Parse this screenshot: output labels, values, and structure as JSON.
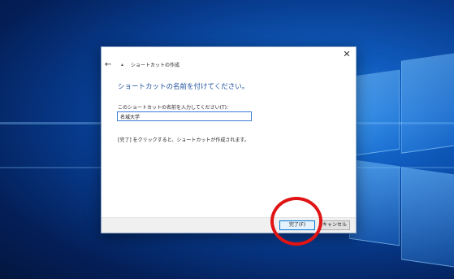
{
  "desktop": {
    "accent": "#0f5bbd"
  },
  "dialog": {
    "title": "ショートカットの作成",
    "back_icon": "back-arrow-icon",
    "close_icon": "close-icon",
    "close_glyph": "✕",
    "back_glyph": "←",
    "wizard_glyph": "▴",
    "heading": "ショートカットの名前を付けてください。",
    "field_label": "このショートカットの名前を入力してください(T):",
    "name_value": "名城大学",
    "info_text": "[完了] をクリックすると、ショートカットが作成されます。",
    "finish_label": "完了(F)",
    "cancel_label": "キャンセル"
  },
  "annotation": {
    "color": "#e01414"
  }
}
